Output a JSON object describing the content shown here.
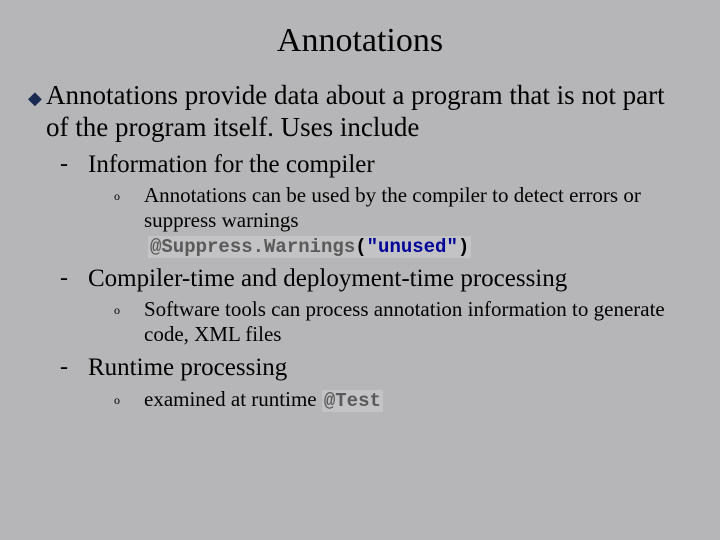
{
  "title": "Annotations",
  "main_point": "Annotations provide data about a program that is not part of the program itself.  Uses include",
  "items": [
    {
      "label": "Information for the compiler",
      "sub": "Annotations can be used by the compiler to detect errors or suppress warnings",
      "code_keyword": "@Suppress.Warnings",
      "code_paren_open": "(",
      "code_string": "\"unused\"",
      "code_paren_close": ")"
    },
    {
      "label": "Compiler-time and deployment-time processing",
      "sub": "Software tools can process annotation information to generate code, XML files"
    },
    {
      "label": "Runtime processing",
      "sub_prefix": "examined at runtime ",
      "sub_code": "@Test"
    }
  ],
  "bullets": {
    "diamond": "◆",
    "dash": "-",
    "circle": "o"
  }
}
